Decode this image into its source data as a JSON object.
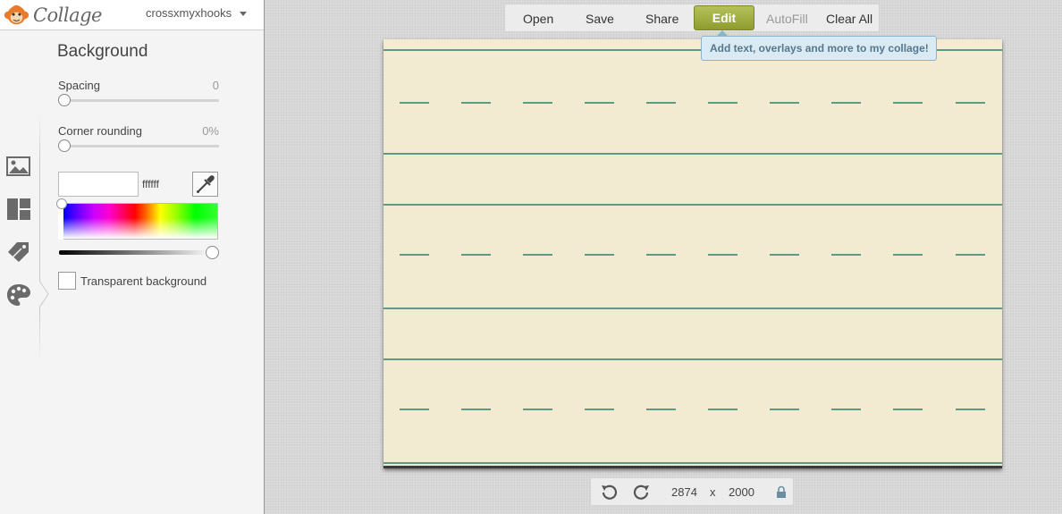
{
  "app": {
    "logo_text": "Collage",
    "username": "crossxmyxhooks"
  },
  "panel": {
    "title": "Background",
    "spacing": {
      "label": "Spacing",
      "value": "0"
    },
    "corner_rounding": {
      "label": "Corner rounding",
      "value": "0%"
    },
    "color": {
      "hex_value": "ffffff",
      "current_color": "#ffffff"
    },
    "transparent_label": "Transparent background"
  },
  "toolbar": {
    "open": "Open",
    "save": "Save",
    "share": "Share",
    "edit": "Edit",
    "autofill": "AutoFill",
    "clear_all": "Clear All"
  },
  "tooltip": "Add text, overlays and more to my collage!",
  "bottombar": {
    "width": "2874",
    "separator": "x",
    "height": "2000"
  },
  "colors": {
    "accent": "#9aa83a",
    "canvas_bg": "#f2ebd2",
    "rule": "#5c9c86",
    "tooltip_bg": "#d9eaf3"
  },
  "rail_icons": [
    "image-icon",
    "layout-icon",
    "tag-icon",
    "palette-icon"
  ]
}
